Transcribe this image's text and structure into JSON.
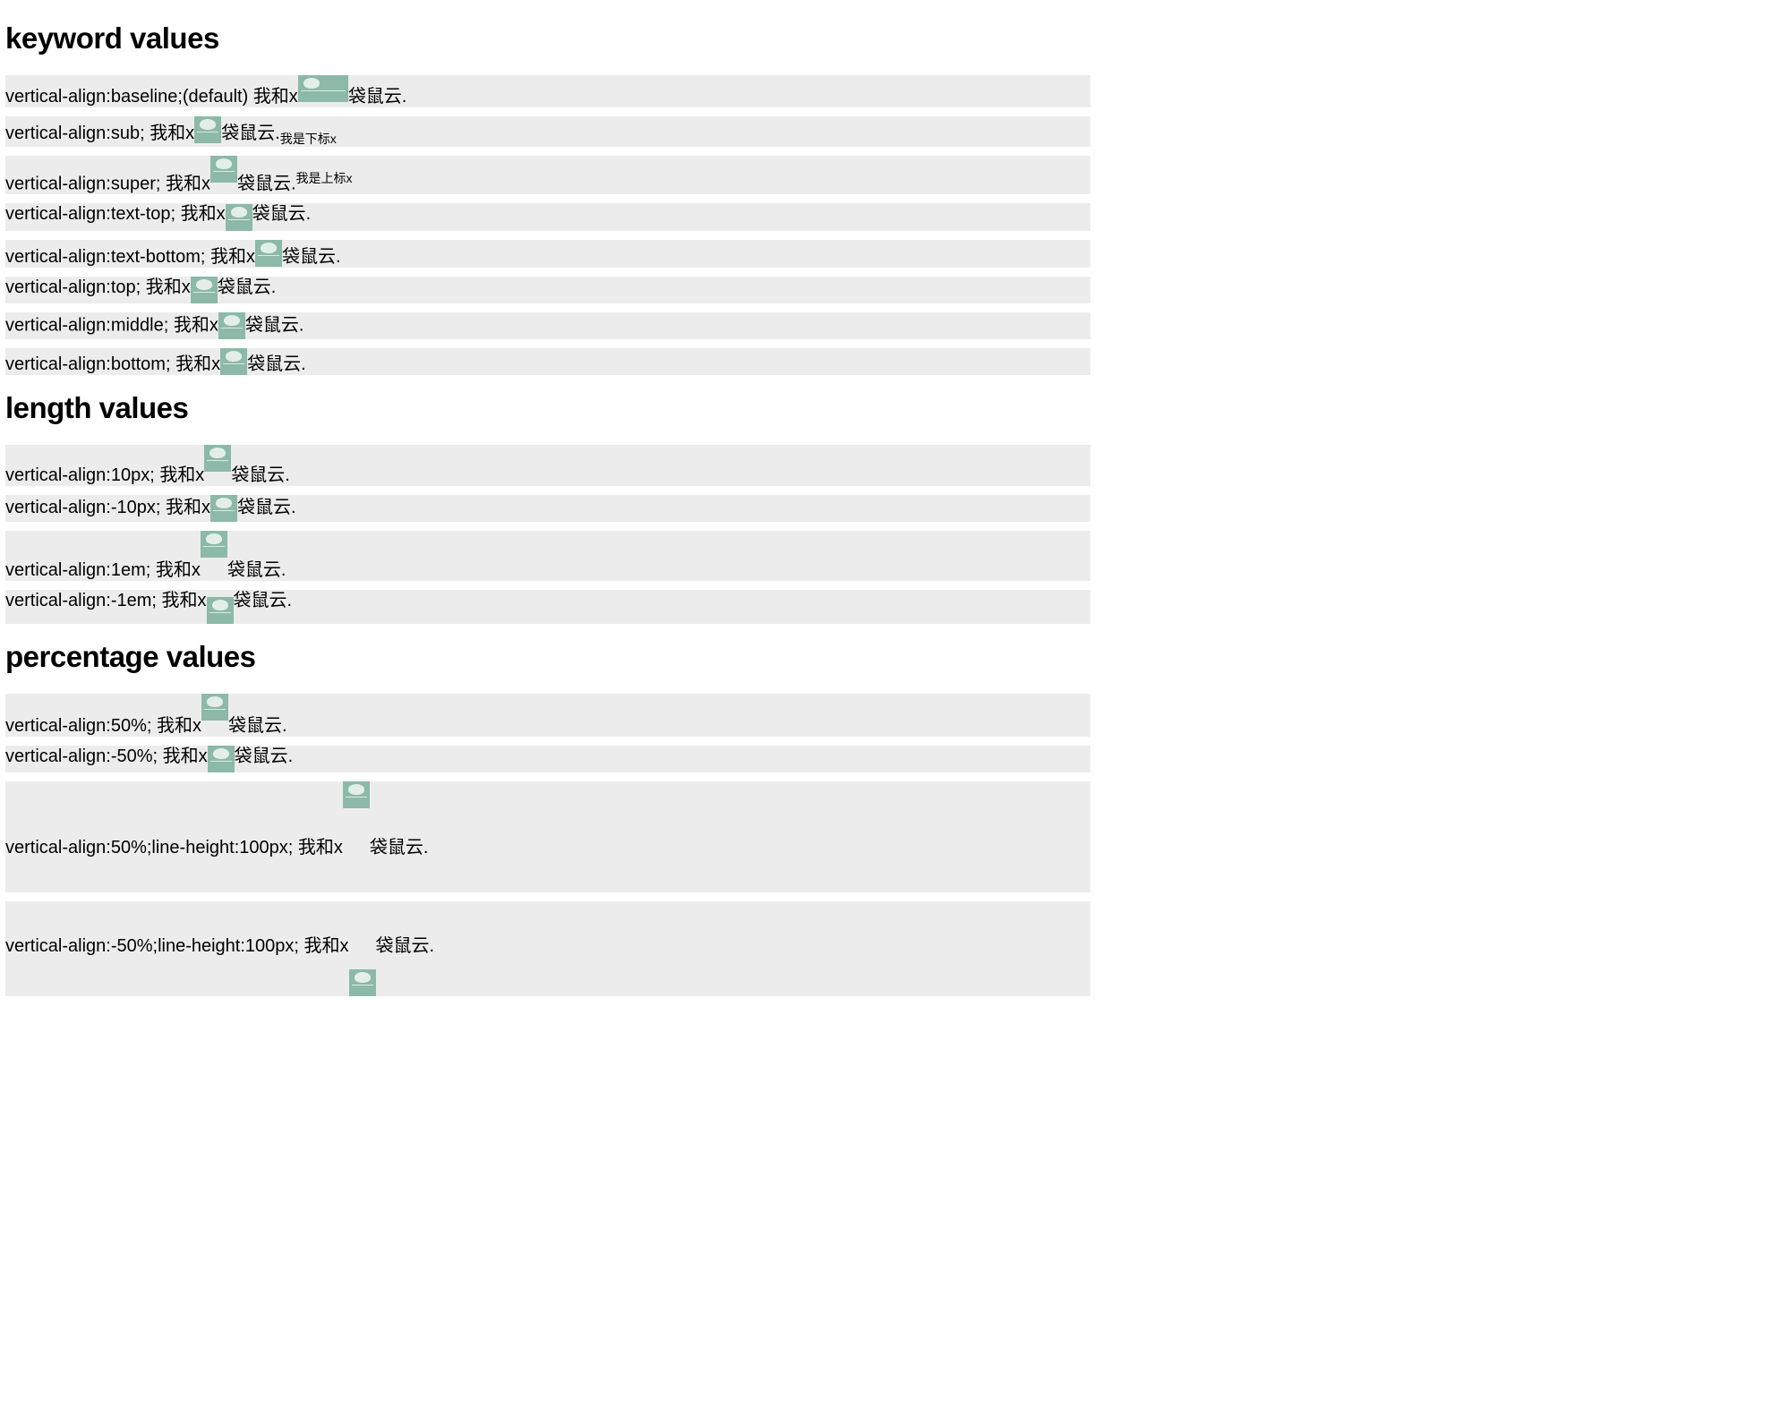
{
  "headings": {
    "keyword": "keyword values",
    "length": "length values",
    "percentage": "percentage values"
  },
  "text": {
    "before": "我和x",
    "after": "袋鼠云.",
    "sub_note": "我是下标x",
    "sup_note": "我是上标x"
  },
  "rows": {
    "baseline": "vertical-align:baseline;(default) ",
    "sub": "vertical-align:sub; ",
    "super": "vertical-align:super; ",
    "texttop": "vertical-align:text-top; ",
    "textbot": "vertical-align:text-bottom; ",
    "top": "vertical-align:top; ",
    "middle": "vertical-align:middle; ",
    "bottom": "vertical-align:bottom; ",
    "p10px": "vertical-align:10px; ",
    "n10px": "vertical-align:-10px; ",
    "p1em": "vertical-align:1em; ",
    "n1em": "vertical-align:-1em; ",
    "p50": "vertical-align:50%; ",
    "n50": "vertical-align:-50%; ",
    "p50lh": "vertical-align:50%;line-height:100px; ",
    "n50lh": "vertical-align:-50%;line-height:100px; "
  }
}
